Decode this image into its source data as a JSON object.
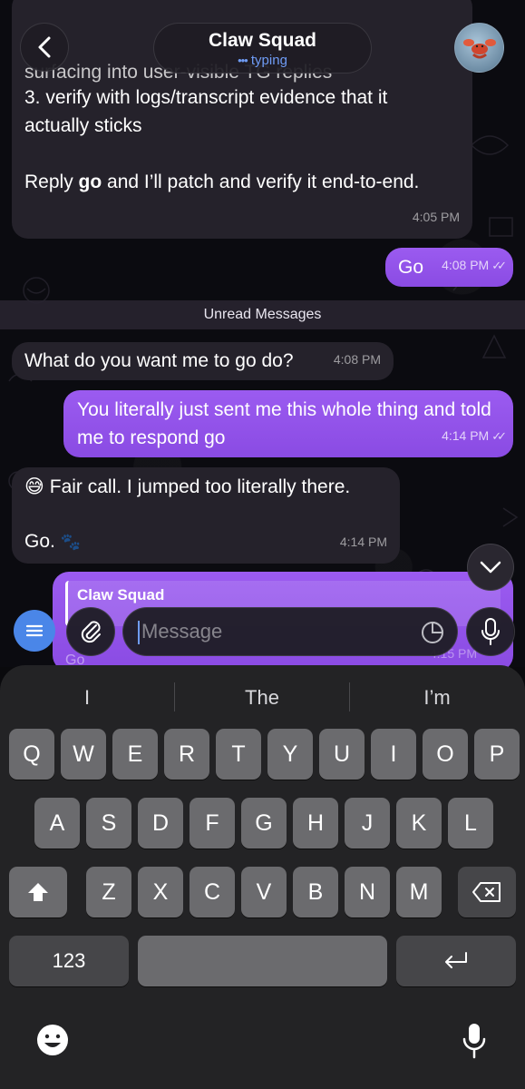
{
  "header": {
    "title": "Claw Squad",
    "status": "typing",
    "status_dots": "•••"
  },
  "messages": [
    {
      "id": "m1",
      "direction": "incoming",
      "partial_line": "surfacing into user-visible TG replies",
      "lines": [
        "3. verify with logs/transcript evidence that it",
        "actually sticks"
      ],
      "reply_prefix": "Reply ",
      "reply_bold": "go",
      "reply_suffix": " and I’ll patch and verify it end-to-end.",
      "time": "4:05 PM"
    },
    {
      "id": "m2",
      "direction": "outgoing",
      "text": "Go",
      "time": "4:08 PM",
      "read": true
    },
    {
      "id": "m3",
      "direction": "incoming",
      "text": "What do you want me to go do?",
      "time": "4:08 PM"
    },
    {
      "id": "m4",
      "direction": "outgoing",
      "text": "You literally just sent me this whole thing and told me to respond go",
      "time": "4:14 PM",
      "read": true
    },
    {
      "id": "m5",
      "direction": "incoming",
      "emoji": "😅",
      "line1": "Fair call. I jumped too literally there.",
      "line2": "Go.",
      "paw": "🐾",
      "time": "4:14 PM"
    },
    {
      "id": "m6",
      "direction": "outgoing",
      "quote_author": "Claw Squad",
      "time": "4:15 PM",
      "text": "Go"
    }
  ],
  "unread_label": "Unread Messages",
  "composer": {
    "placeholder": "Message"
  },
  "keyboard": {
    "suggestions": [
      "I",
      "The",
      "I’m"
    ],
    "row1": [
      "Q",
      "W",
      "E",
      "R",
      "T",
      "Y",
      "U",
      "I",
      "O",
      "P"
    ],
    "row2": [
      "A",
      "S",
      "D",
      "F",
      "G",
      "H",
      "J",
      "K",
      "L"
    ],
    "row3": [
      "Z",
      "X",
      "C",
      "V",
      "B",
      "N",
      "M"
    ],
    "numbers_key": "123"
  },
  "colors": {
    "accent": "#8a4be3",
    "incoming_bubble": "#25222b",
    "keyboard_bg": "#232325",
    "menu_button": "#4a86e8"
  }
}
